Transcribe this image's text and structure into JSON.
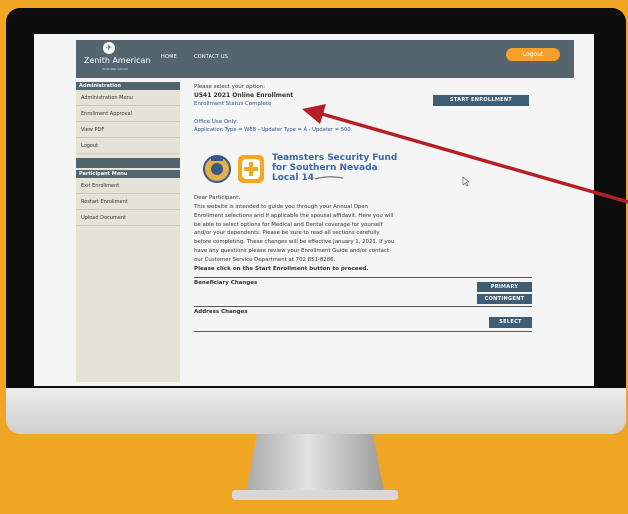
{
  "header": {
    "logo_mark": "✈",
    "logo_name": "Zenith American",
    "logo_tagline": "HOLDING GROUP",
    "nav_home": "HOME",
    "nav_contact": "CONTACT US",
    "logout": "Logout"
  },
  "sidebar": {
    "admin_heading": "Administration",
    "admin_items": [
      "Administration Menu",
      "Enrollment Approval",
      "View PDF",
      "Logout"
    ],
    "participant_heading": "Participant Menu",
    "participant_items": [
      "Exit Enrollment",
      "Restart Enrollment",
      "Upload Document"
    ]
  },
  "main": {
    "prompt": "Please select your option:",
    "enrollment_title": "U541 2021 Online Enrollment",
    "status_link": "Enrollment Status Complete",
    "start_button": "START ENROLLMENT",
    "office_use_label": "Office Use Only:",
    "office_use_value": "Application Type = WEB - Updater Type = A - Updater = 500",
    "fund_name_line1": "Teamsters Security Fund",
    "fund_name_line2": "for Southern Nevada",
    "fund_name_line3": "Local 14",
    "greeting": "Dear Participant,",
    "body_lines": [
      "This website is intended to guide you through your Annual Open",
      "Enrollment selections and if applicable the spousal affidavit. Here you will",
      "be able to select options for Medical and Dental coverage for yourself",
      "and/or your dependents. Please be sure to read all sections carefully",
      "before completing. These changes will be effective January 1, 2021. If you",
      "have any questions please review your Enrollment Guide and/or contact",
      "our Customer Service Department at 702 851-8286."
    ],
    "instruction": "Please click on the Start Enrollment button to proceed.",
    "beneficiary_label": "Beneficiary Changes",
    "primary_button": "PRIMARY",
    "contingent_button": "CONTINGENT",
    "address_label": "Address Changes",
    "select_button": "SELECT"
  },
  "colors": {
    "background": "#f0a623",
    "header": "#54656f",
    "accent_orange": "#f3a12b",
    "button_blue": "#3f5d74",
    "arrow_red": "#b51f25"
  }
}
